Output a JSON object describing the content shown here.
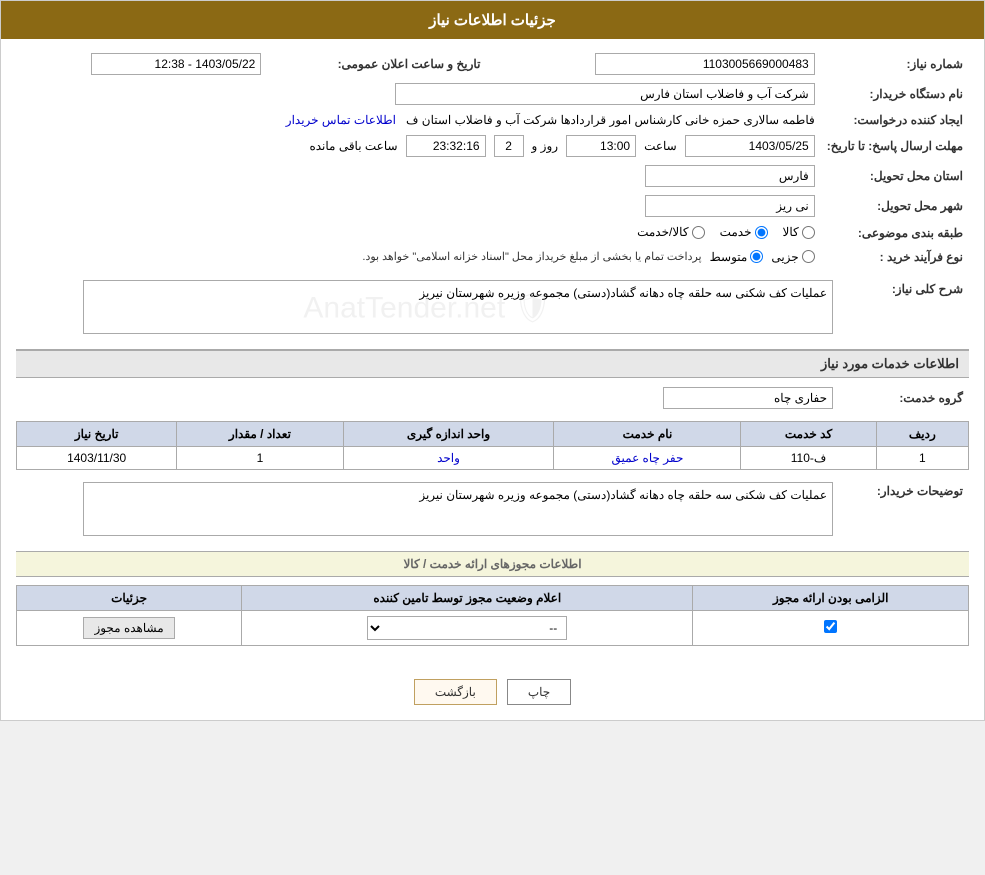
{
  "page": {
    "title": "جزئیات اطلاعات نیاز"
  },
  "header": {
    "shomareNiaz_label": "شماره نیاز:",
    "shomareNiaz_value": "1103005669000483",
    "namDastgah_label": "نام دستگاه خریدار:",
    "namDastgah_value": "شرکت آب و فاضلاب استان فارس",
    "tarikh_label": "تاریخ و ساعت اعلان عمومی:",
    "tarikh_value": "1403/05/22 - 12:38",
    "ijadKonande_label": "ایجاد کننده درخواست:",
    "ijadKonande_value": "فاطمه سالاری حمزه خانی کارشناس امور قراردادها شرکت آب و فاضلاب استان ف",
    "ijadKonande_link": "اطلاعات تماس خریدار",
    "mohlat_label": "مهلت ارسال پاسخ: تا تاریخ:",
    "mohlat_date": "1403/05/25",
    "mohlat_time": "13:00",
    "mohlat_days": "2",
    "mohlat_countdown": "23:32:16",
    "mohlat_remaining": "ساعت باقی مانده",
    "ostan_label": "استان محل تحویل:",
    "ostan_value": "فارس",
    "shahr_label": "شهر محل تحویل:",
    "shahr_value": "نی ریز",
    "tabaqe_label": "طبقه بندی موضوعی:",
    "tabaqe_kala": "کالا",
    "tabaqe_khedmat": "خدمت",
    "tabaqe_kala_khedmat": "کالا/خدمت",
    "noeFarayand_label": "نوع فرآیند خرید :",
    "noeFarayand_jozi": "جزیی",
    "noeFarayand_motavasset": "متوسط",
    "noeFarayand_note": "پرداخت تمام یا بخشی از مبلغ خریداز محل \"اسناد خزانه اسلامی\" خواهد بود.",
    "sharh_label": "شرح کلی نیاز:",
    "sharh_value": "عملیات کف شکنی سه حلقه چاه دهانه گشاد(دستی) مجموعه وزیره شهرستان نیریز",
    "services_title": "اطلاعات خدمات مورد نیاز",
    "grohe_label": "گروه خدمت:",
    "grohe_value": "حفاری چاه",
    "table": {
      "headers": [
        "ردیف",
        "کد خدمت",
        "نام خدمت",
        "واحد اندازه گیری",
        "تعداد / مقدار",
        "تاریخ نیاز"
      ],
      "rows": [
        {
          "radif": "1",
          "kod": "ف-110",
          "name": "حفر چاه عمیق",
          "unit": "واحد",
          "count": "1",
          "date": "1403/11/30"
        }
      ]
    },
    "buyer_notes_label": "توضیحات خریدار:",
    "buyer_notes_value": "عملیات کف شکنی سه حلقه چاه دهانه گشاد(دستی) مجموعه وزیره شهرستان نیریز",
    "license_section_title": "اطلاعات مجوزهای ارائه خدمت / کالا",
    "license_table": {
      "headers": [
        "الزامی بودن ارائه مجوز",
        "اعلام وضعیت مجوز توسط تامین کننده",
        "جزئیات"
      ],
      "rows": [
        {
          "required": true,
          "status_value": "--",
          "details_btn": "مشاهده مجوز"
        }
      ]
    }
  },
  "buttons": {
    "print": "چاپ",
    "back": "بازگشت"
  }
}
